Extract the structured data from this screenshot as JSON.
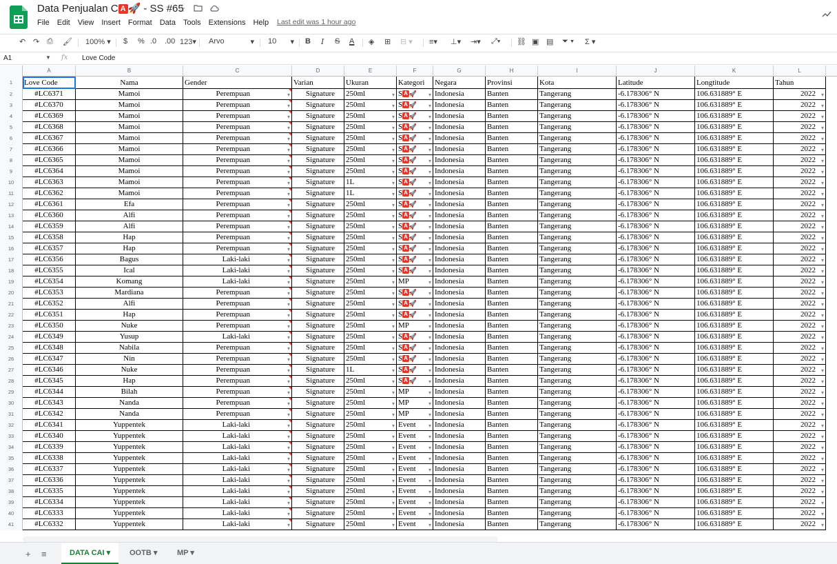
{
  "app": {
    "title_prefix": "Data Penjualan C",
    "title_badge": "A",
    "title_suffix": "🚀 - SS #65",
    "last_edit": "Last edit was 1 hour ago",
    "menu": [
      "File",
      "Edit",
      "View",
      "Insert",
      "Format",
      "Data",
      "Tools",
      "Extensions",
      "Help"
    ]
  },
  "toolbar": {
    "zoom": "100%",
    "currency": "$",
    "percent": "%",
    "dec_less": ".0",
    "dec_more": ".00",
    "number_format": "123",
    "font": "Arvo",
    "font_size": "10"
  },
  "formula": {
    "name_box": "A1",
    "fx": "fx",
    "value": "Love Code"
  },
  "columns": [
    "A",
    "B",
    "C",
    "D",
    "E",
    "F",
    "G",
    "H",
    "I",
    "J",
    "K",
    "L"
  ],
  "headers": [
    "Love Code",
    "Nama",
    "Gender",
    "Varian",
    "Ukuran",
    "Kategori",
    "Negara",
    "Provinsi",
    "Kota",
    "Latitude",
    "Longtitude",
    "Tahun"
  ],
  "rows": [
    {
      "n": "2",
      "code": "#LC6371",
      "nama": "Mamoi",
      "gender": "Perempuan",
      "varian": "Signature",
      "ukuran": "250ml",
      "kategori": "SA",
      "negara": "Indonesia",
      "provinsi": "Banten",
      "kota": "Tangerang",
      "lat": "-6.178306° N",
      "lng": "106.631889° E",
      "tahun": "2022"
    },
    {
      "n": "3",
      "code": "#LC6370",
      "nama": "Mamoi",
      "gender": "Perempuan",
      "varian": "Signature",
      "ukuran": "250ml",
      "kategori": "SA",
      "negara": "Indonesia",
      "provinsi": "Banten",
      "kota": "Tangerang",
      "lat": "-6.178306° N",
      "lng": "106.631889° E",
      "tahun": "2022"
    },
    {
      "n": "4",
      "code": "#LC6369",
      "nama": "Mamoi",
      "gender": "Perempuan",
      "varian": "Signature",
      "ukuran": "250ml",
      "kategori": "SA",
      "negara": "Indonesia",
      "provinsi": "Banten",
      "kota": "Tangerang",
      "lat": "-6.178306° N",
      "lng": "106.631889° E",
      "tahun": "2022"
    },
    {
      "n": "5",
      "code": "#LC6368",
      "nama": "Mamoi",
      "gender": "Perempuan",
      "varian": "Signature",
      "ukuran": "250ml",
      "kategori": "SA",
      "negara": "Indonesia",
      "provinsi": "Banten",
      "kota": "Tangerang",
      "lat": "-6.178306° N",
      "lng": "106.631889° E",
      "tahun": "2022"
    },
    {
      "n": "6",
      "code": "#LC6367",
      "nama": "Mamoi",
      "gender": "Perempuan",
      "varian": "Signature",
      "ukuran": "250ml",
      "kategori": "SA",
      "negara": "Indonesia",
      "provinsi": "Banten",
      "kota": "Tangerang",
      "lat": "-6.178306° N",
      "lng": "106.631889° E",
      "tahun": "2022"
    },
    {
      "n": "7",
      "code": "#LC6366",
      "nama": "Mamoi",
      "gender": "Perempuan",
      "varian": "Signature",
      "ukuran": "250ml",
      "kategori": "SA",
      "negara": "Indonesia",
      "provinsi": "Banten",
      "kota": "Tangerang",
      "lat": "-6.178306° N",
      "lng": "106.631889° E",
      "tahun": "2022"
    },
    {
      "n": "8",
      "code": "#LC6365",
      "nama": "Mamoi",
      "gender": "Perempuan",
      "varian": "Signature",
      "ukuran": "250ml",
      "kategori": "SA",
      "negara": "Indonesia",
      "provinsi": "Banten",
      "kota": "Tangerang",
      "lat": "-6.178306° N",
      "lng": "106.631889° E",
      "tahun": "2022"
    },
    {
      "n": "9",
      "code": "#LC6364",
      "nama": "Mamoi",
      "gender": "Perempuan",
      "varian": "Signature",
      "ukuran": "250ml",
      "kategori": "SA",
      "negara": "Indonesia",
      "provinsi": "Banten",
      "kota": "Tangerang",
      "lat": "-6.178306° N",
      "lng": "106.631889° E",
      "tahun": "2022"
    },
    {
      "n": "10",
      "code": "#LC6363",
      "nama": "Mamoi",
      "gender": "Perempuan",
      "varian": "Signature",
      "ukuran": "1L",
      "kategori": "SA",
      "negara": "Indonesia",
      "provinsi": "Banten",
      "kota": "Tangerang",
      "lat": "-6.178306° N",
      "lng": "106.631889° E",
      "tahun": "2022"
    },
    {
      "n": "11",
      "code": "#LC6362",
      "nama": "Mamoi",
      "gender": "Perempuan",
      "varian": "Signature",
      "ukuran": "1L",
      "kategori": "SA",
      "negara": "Indonesia",
      "provinsi": "Banten",
      "kota": "Tangerang",
      "lat": "-6.178306° N",
      "lng": "106.631889° E",
      "tahun": "2022"
    },
    {
      "n": "12",
      "code": "#LC6361",
      "nama": "Efa",
      "gender": "Perempuan",
      "varian": "Signature",
      "ukuran": "250ml",
      "kategori": "SA",
      "negara": "Indonesia",
      "provinsi": "Banten",
      "kota": "Tangerang",
      "lat": "-6.178306° N",
      "lng": "106.631889° E",
      "tahun": "2022"
    },
    {
      "n": "13",
      "code": "#LC6360",
      "nama": "Alfi",
      "gender": "Perempuan",
      "varian": "Signature",
      "ukuran": "250ml",
      "kategori": "SA",
      "negara": "Indonesia",
      "provinsi": "Banten",
      "kota": "Tangerang",
      "lat": "-6.178306° N",
      "lng": "106.631889° E",
      "tahun": "2022"
    },
    {
      "n": "14",
      "code": "#LC6359",
      "nama": "Alfi",
      "gender": "Perempuan",
      "varian": "Signature",
      "ukuran": "250ml",
      "kategori": "SA",
      "negara": "Indonesia",
      "provinsi": "Banten",
      "kota": "Tangerang",
      "lat": "-6.178306° N",
      "lng": "106.631889° E",
      "tahun": "2022"
    },
    {
      "n": "15",
      "code": "#LC6358",
      "nama": "Hap",
      "gender": "Perempuan",
      "varian": "Signature",
      "ukuran": "250ml",
      "kategori": "SA",
      "negara": "Indonesia",
      "provinsi": "Banten",
      "kota": "Tangerang",
      "lat": "-6.178306° N",
      "lng": "106.631889° E",
      "tahun": "2022"
    },
    {
      "n": "16",
      "code": "#LC6357",
      "nama": "Hap",
      "gender": "Perempuan",
      "varian": "Signature",
      "ukuran": "250ml",
      "kategori": "SA",
      "negara": "Indonesia",
      "provinsi": "Banten",
      "kota": "Tangerang",
      "lat": "-6.178306° N",
      "lng": "106.631889° E",
      "tahun": "2022"
    },
    {
      "n": "17",
      "code": "#LC6356",
      "nama": "Bagus",
      "gender": "Laki-laki",
      "varian": "Signature",
      "ukuran": "250ml",
      "kategori": "SA",
      "negara": "Indonesia",
      "provinsi": "Banten",
      "kota": "Tangerang",
      "lat": "-6.178306° N",
      "lng": "106.631889° E",
      "tahun": "2022"
    },
    {
      "n": "18",
      "code": "#LC6355",
      "nama": "Ical",
      "gender": "Laki-laki",
      "varian": "Signature",
      "ukuran": "250ml",
      "kategori": "SA",
      "negara": "Indonesia",
      "provinsi": "Banten",
      "kota": "Tangerang",
      "lat": "-6.178306° N",
      "lng": "106.631889° E",
      "tahun": "2022"
    },
    {
      "n": "19",
      "code": "#LC6354",
      "nama": "Komang",
      "gender": "Laki-laki",
      "varian": "Signature",
      "ukuran": "250ml",
      "kategori": "MP",
      "negara": "Indonesia",
      "provinsi": "Banten",
      "kota": "Tangerang",
      "lat": "-6.178306° N",
      "lng": "106.631889° E",
      "tahun": "2022"
    },
    {
      "n": "20",
      "code": "#LC6353",
      "nama": "Mardiana",
      "gender": "Perempuan",
      "varian": "Signature",
      "ukuran": "250ml",
      "kategori": "SA",
      "negara": "Indonesia",
      "provinsi": "Banten",
      "kota": "Tangerang",
      "lat": "-6.178306° N",
      "lng": "106.631889° E",
      "tahun": "2022"
    },
    {
      "n": "21",
      "code": "#LC6352",
      "nama": "Alfi",
      "gender": "Perempuan",
      "varian": "Signature",
      "ukuran": "250ml",
      "kategori": "SA",
      "negara": "Indonesia",
      "provinsi": "Banten",
      "kota": "Tangerang",
      "lat": "-6.178306° N",
      "lng": "106.631889° E",
      "tahun": "2022"
    },
    {
      "n": "22",
      "code": "#LC6351",
      "nama": "Hap",
      "gender": "Perempuan",
      "varian": "Signature",
      "ukuran": "250ml",
      "kategori": "SA",
      "negara": "Indonesia",
      "provinsi": "Banten",
      "kota": "Tangerang",
      "lat": "-6.178306° N",
      "lng": "106.631889° E",
      "tahun": "2022"
    },
    {
      "n": "23",
      "code": "#LC6350",
      "nama": "Nuke",
      "gender": "Perempuan",
      "varian": "Signature",
      "ukuran": "250ml",
      "kategori": "MP",
      "negara": "Indonesia",
      "provinsi": "Banten",
      "kota": "Tangerang",
      "lat": "-6.178306° N",
      "lng": "106.631889° E",
      "tahun": "2022"
    },
    {
      "n": "24",
      "code": "#LC6349",
      "nama": "Yusup",
      "gender": "Laki-laki",
      "varian": "Signature",
      "ukuran": "250ml",
      "kategori": "SA",
      "negara": "Indonesia",
      "provinsi": "Banten",
      "kota": "Tangerang",
      "lat": "-6.178306° N",
      "lng": "106.631889° E",
      "tahun": "2022"
    },
    {
      "n": "25",
      "code": "#LC6348",
      "nama": "Nabila",
      "gender": "Perempuan",
      "varian": "Signature",
      "ukuran": "250ml",
      "kategori": "SA",
      "negara": "Indonesia",
      "provinsi": "Banten",
      "kota": "Tangerang",
      "lat": "-6.178306° N",
      "lng": "106.631889° E",
      "tahun": "2022"
    },
    {
      "n": "26",
      "code": "#LC6347",
      "nama": "Nin",
      "gender": "Perempuan",
      "varian": "Signature",
      "ukuran": "250ml",
      "kategori": "SA",
      "negara": "Indonesia",
      "provinsi": "Banten",
      "kota": "Tangerang",
      "lat": "-6.178306° N",
      "lng": "106.631889° E",
      "tahun": "2022"
    },
    {
      "n": "27",
      "code": "#LC6346",
      "nama": "Nuke",
      "gender": "Perempuan",
      "varian": "Signature",
      "ukuran": "1L",
      "kategori": "SA",
      "negara": "Indonesia",
      "provinsi": "Banten",
      "kota": "Tangerang",
      "lat": "-6.178306° N",
      "lng": "106.631889° E",
      "tahun": "2022"
    },
    {
      "n": "28",
      "code": "#LC6345",
      "nama": "Hap",
      "gender": "Perempuan",
      "varian": "Signature",
      "ukuran": "250ml",
      "kategori": "SA",
      "negara": "Indonesia",
      "provinsi": "Banten",
      "kota": "Tangerang",
      "lat": "-6.178306° N",
      "lng": "106.631889° E",
      "tahun": "2022"
    },
    {
      "n": "29",
      "code": "#LC6344",
      "nama": "Bilah",
      "gender": "Perempuan",
      "varian": "Signature",
      "ukuran": "250ml",
      "kategori": "MP",
      "negara": "Indonesia",
      "provinsi": "Banten",
      "kota": "Tangerang",
      "lat": "-6.178306° N",
      "lng": "106.631889° E",
      "tahun": "2022"
    },
    {
      "n": "30",
      "code": "#LC6343",
      "nama": "Nanda",
      "gender": "Perempuan",
      "varian": "Signature",
      "ukuran": "250ml",
      "kategori": "MP",
      "negara": "Indonesia",
      "provinsi": "Banten",
      "kota": "Tangerang",
      "lat": "-6.178306° N",
      "lng": "106.631889° E",
      "tahun": "2022"
    },
    {
      "n": "31",
      "code": "#LC6342",
      "nama": "Nanda",
      "gender": "Perempuan",
      "varian": "Signature",
      "ukuran": "250ml",
      "kategori": "MP",
      "negara": "Indonesia",
      "provinsi": "Banten",
      "kota": "Tangerang",
      "lat": "-6.178306° N",
      "lng": "106.631889° E",
      "tahun": "2022"
    },
    {
      "n": "32",
      "code": "#LC6341",
      "nama": "Yuppentek",
      "gender": "Laki-laki",
      "varian": "Signature",
      "ukuran": "250ml",
      "kategori": "Event",
      "negara": "Indonesia",
      "provinsi": "Banten",
      "kota": "Tangerang",
      "lat": "-6.178306° N",
      "lng": "106.631889° E",
      "tahun": "2022"
    },
    {
      "n": "33",
      "code": "#LC6340",
      "nama": "Yuppentek",
      "gender": "Laki-laki",
      "varian": "Signature",
      "ukuran": "250ml",
      "kategori": "Event",
      "negara": "Indonesia",
      "provinsi": "Banten",
      "kota": "Tangerang",
      "lat": "-6.178306° N",
      "lng": "106.631889° E",
      "tahun": "2022"
    },
    {
      "n": "34",
      "code": "#LC6339",
      "nama": "Yuppentek",
      "gender": "Laki-laki",
      "varian": "Signature",
      "ukuran": "250ml",
      "kategori": "Event",
      "negara": "Indonesia",
      "provinsi": "Banten",
      "kota": "Tangerang",
      "lat": "-6.178306° N",
      "lng": "106.631889° E",
      "tahun": "2022"
    },
    {
      "n": "35",
      "code": "#LC6338",
      "nama": "Yuppentek",
      "gender": "Laki-laki",
      "varian": "Signature",
      "ukuran": "250ml",
      "kategori": "Event",
      "negara": "Indonesia",
      "provinsi": "Banten",
      "kota": "Tangerang",
      "lat": "-6.178306° N",
      "lng": "106.631889° E",
      "tahun": "2022"
    },
    {
      "n": "36",
      "code": "#LC6337",
      "nama": "Yuppentek",
      "gender": "Laki-laki",
      "varian": "Signature",
      "ukuran": "250ml",
      "kategori": "Event",
      "negara": "Indonesia",
      "provinsi": "Banten",
      "kota": "Tangerang",
      "lat": "-6.178306° N",
      "lng": "106.631889° E",
      "tahun": "2022"
    },
    {
      "n": "37",
      "code": "#LC6336",
      "nama": "Yuppentek",
      "gender": "Laki-laki",
      "varian": "Signature",
      "ukuran": "250ml",
      "kategori": "Event",
      "negara": "Indonesia",
      "provinsi": "Banten",
      "kota": "Tangerang",
      "lat": "-6.178306° N",
      "lng": "106.631889° E",
      "tahun": "2022"
    },
    {
      "n": "38",
      "code": "#LC6335",
      "nama": "Yuppentek",
      "gender": "Laki-laki",
      "varian": "Signature",
      "ukuran": "250ml",
      "kategori": "Event",
      "negara": "Indonesia",
      "provinsi": "Banten",
      "kota": "Tangerang",
      "lat": "-6.178306° N",
      "lng": "106.631889° E",
      "tahun": "2022"
    },
    {
      "n": "39",
      "code": "#LC6334",
      "nama": "Yuppentek",
      "gender": "Laki-laki",
      "varian": "Signature",
      "ukuran": "250ml",
      "kategori": "Event",
      "negara": "Indonesia",
      "provinsi": "Banten",
      "kota": "Tangerang",
      "lat": "-6.178306° N",
      "lng": "106.631889° E",
      "tahun": "2022"
    },
    {
      "n": "40",
      "code": "#LC6333",
      "nama": "Yuppentek",
      "gender": "Laki-laki",
      "varian": "Signature",
      "ukuran": "250ml",
      "kategori": "Event",
      "negara": "Indonesia",
      "provinsi": "Banten",
      "kota": "Tangerang",
      "lat": "-6.178306° N",
      "lng": "106.631889° E",
      "tahun": "2022"
    },
    {
      "n": "41",
      "code": "#LC6332",
      "nama": "Yuppentek",
      "gender": "Laki-laki",
      "varian": "Signature",
      "ukuran": "250ml",
      "kategori": "Event",
      "negara": "Indonesia",
      "provinsi": "Banten",
      "kota": "Tangerang",
      "lat": "-6.178306° N",
      "lng": "106.631889° E",
      "tahun": "2022"
    }
  ],
  "sheets": [
    {
      "label": "DATA CAI",
      "active": true
    },
    {
      "label": "OOTB",
      "active": false
    },
    {
      "label": "MP",
      "active": false
    }
  ],
  "colors": {
    "accent_green": "#188038",
    "selection_blue": "#1a73e8",
    "validation_red": "#e8362b"
  }
}
